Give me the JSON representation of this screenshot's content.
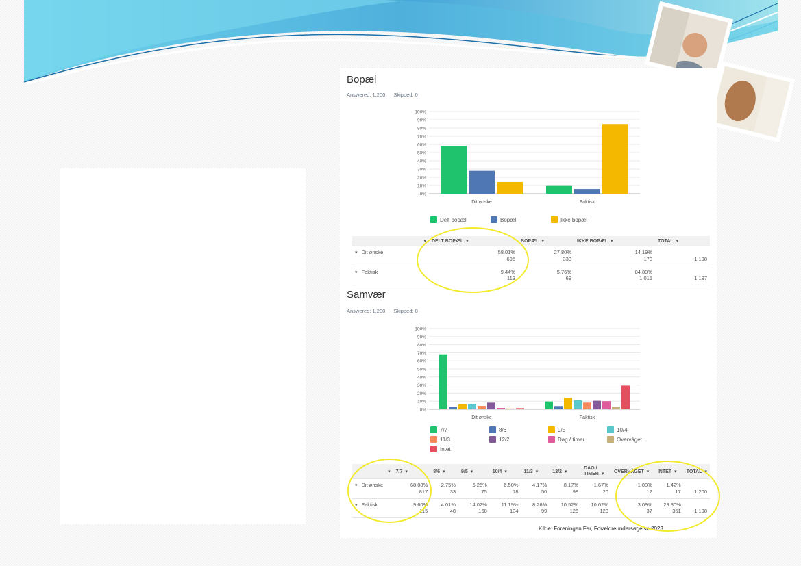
{
  "source_note": "Kilde: Foreningen Far, Forældreundersøgelse 2023",
  "colors": {
    "green": "#1fc36e",
    "blue": "#4e77b4",
    "yellow": "#f5b800",
    "teal": "#5bc6cc",
    "orange": "#f58a5c",
    "purple": "#845a9a",
    "pink": "#df5c9c",
    "olive": "#c6b07a",
    "red": "#e2505f",
    "highlight": "#f2ea2a"
  },
  "icons": {
    "sort": "caret-down-icon",
    "expand": "caret-down-icon"
  },
  "bopael": {
    "title": "Bopæl",
    "answered": "Answered: 1,200",
    "skipped": "Skipped: 0",
    "table": {
      "headers": [
        "",
        "DELT BOPÆL",
        "BOPÆL",
        "IKKE BOPÆL",
        "TOTAL"
      ],
      "rows": [
        {
          "label": "Dit ønske",
          "cells": [
            {
              "pct": "58.01%",
              "n": "695"
            },
            {
              "pct": "27.80%",
              "n": "333"
            },
            {
              "pct": "14.19%",
              "n": "170"
            }
          ],
          "total": "1,198"
        },
        {
          "label": "Faktisk",
          "cells": [
            {
              "pct": "9.44%",
              "n": "113"
            },
            {
              "pct": "5.76%",
              "n": "69"
            },
            {
              "pct": "84.80%",
              "n": "1,015"
            }
          ],
          "total": "1,197"
        }
      ]
    }
  },
  "samvaer": {
    "title": "Samvær",
    "answered": "Answered: 1,200",
    "skipped": "Skipped: 0",
    "table": {
      "headers": [
        "",
        "7/7",
        "8/6",
        "9/5",
        "10/4",
        "11/3",
        "12/2",
        "DAG / TIMER",
        "OVERVÅGET",
        "INTET",
        "TOTAL"
      ],
      "rows": [
        {
          "label": "Dit ønske",
          "cells": [
            {
              "pct": "68.08%",
              "n": "817"
            },
            {
              "pct": "2.75%",
              "n": "33"
            },
            {
              "pct": "6.25%",
              "n": "75"
            },
            {
              "pct": "6.50%",
              "n": "78"
            },
            {
              "pct": "4.17%",
              "n": "50"
            },
            {
              "pct": "8.17%",
              "n": "98"
            },
            {
              "pct": "1.67%",
              "n": "20"
            },
            {
              "pct": "1.00%",
              "n": "12"
            },
            {
              "pct": "1.42%",
              "n": "17"
            }
          ],
          "total": "1,200"
        },
        {
          "label": "Faktisk",
          "cells": [
            {
              "pct": "9.60%",
              "n": "115"
            },
            {
              "pct": "4.01%",
              "n": "48"
            },
            {
              "pct": "14.02%",
              "n": "168"
            },
            {
              "pct": "11.19%",
              "n": "134"
            },
            {
              "pct": "8.26%",
              "n": "99"
            },
            {
              "pct": "10.52%",
              "n": "126"
            },
            {
              "pct": "10.02%",
              "n": "120"
            },
            {
              "pct": "3.09%",
              "n": "37"
            },
            {
              "pct": "29.30%",
              "n": "351"
            }
          ],
          "total": "1,198"
        }
      ]
    }
  },
  "chart_data": [
    {
      "type": "bar",
      "title": "Bopæl",
      "categories": [
        "Dit ønske",
        "Faktisk"
      ],
      "series": [
        {
          "name": "Delt bopæl",
          "color": "#1fc36e",
          "values": [
            58.01,
            9.44
          ]
        },
        {
          "name": "Bopæl",
          "color": "#4e77b4",
          "values": [
            27.8,
            5.76
          ]
        },
        {
          "name": "Ikke bopæl",
          "color": "#f5b800",
          "values": [
            14.19,
            84.8
          ]
        }
      ],
      "yticks": [
        "0%",
        "10%",
        "20%",
        "30%",
        "40%",
        "50%",
        "60%",
        "70%",
        "80%",
        "90%",
        "100%"
      ],
      "ylim": [
        0,
        100
      ],
      "grid": true,
      "legend": "bottom"
    },
    {
      "type": "bar",
      "title": "Samvær",
      "categories": [
        "Dit ønske",
        "Faktisk"
      ],
      "series": [
        {
          "name": "7/7",
          "color": "#1fc36e",
          "values": [
            68.08,
            9.6
          ]
        },
        {
          "name": "8/6",
          "color": "#4e77b4",
          "values": [
            2.75,
            4.01
          ]
        },
        {
          "name": "9/5",
          "color": "#f5b800",
          "values": [
            6.25,
            14.02
          ]
        },
        {
          "name": "10/4",
          "color": "#5bc6cc",
          "values": [
            6.5,
            11.19
          ]
        },
        {
          "name": "11/3",
          "color": "#f58a5c",
          "values": [
            4.17,
            8.26
          ]
        },
        {
          "name": "12/2",
          "color": "#845a9a",
          "values": [
            8.17,
            10.52
          ]
        },
        {
          "name": "Dag / timer",
          "color": "#df5c9c",
          "values": [
            1.67,
            10.02
          ]
        },
        {
          "name": "Overvåget",
          "color": "#c6b07a",
          "values": [
            1.0,
            3.09
          ]
        },
        {
          "name": "Intet",
          "color": "#e2505f",
          "values": [
            1.42,
            29.3
          ]
        }
      ],
      "yticks": [
        "0%",
        "10%",
        "20%",
        "30%",
        "40%",
        "50%",
        "60%",
        "70%",
        "80%",
        "90%",
        "100%"
      ],
      "ylim": [
        0,
        100
      ],
      "grid": true,
      "legend": "bottom"
    }
  ]
}
